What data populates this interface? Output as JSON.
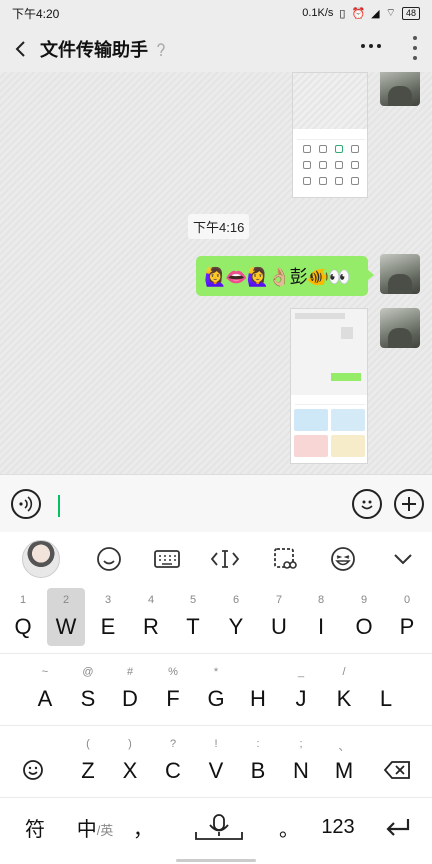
{
  "status_bar": {
    "time": "下午4:20",
    "network_speed": "0.1K/s",
    "battery": "48"
  },
  "header": {
    "title": "文件传输助手"
  },
  "chat": {
    "timestamp": "下午4:16",
    "message_text": "🙋‍♀️👄🙋‍♀️👌🏼彭🐠👀"
  },
  "input": {
    "value": ""
  },
  "keyboard": {
    "row1": [
      {
        "main": "Q",
        "sub": "1"
      },
      {
        "main": "W",
        "sub": "2"
      },
      {
        "main": "E",
        "sub": "3"
      },
      {
        "main": "R",
        "sub": "4"
      },
      {
        "main": "T",
        "sub": "5"
      },
      {
        "main": "Y",
        "sub": "6"
      },
      {
        "main": "U",
        "sub": "7"
      },
      {
        "main": "I",
        "sub": "8"
      },
      {
        "main": "O",
        "sub": "9"
      },
      {
        "main": "P",
        "sub": "0"
      }
    ],
    "row2": [
      {
        "main": "A",
        "sub": "~"
      },
      {
        "main": "S",
        "sub": "@"
      },
      {
        "main": "D",
        "sub": "#"
      },
      {
        "main": "F",
        "sub": "%"
      },
      {
        "main": "G",
        "sub": "*"
      },
      {
        "main": "H",
        "sub": ""
      },
      {
        "main": "J",
        "sub": "_"
      },
      {
        "main": "K",
        "sub": "/"
      },
      {
        "main": "L",
        "sub": ""
      }
    ],
    "row3": [
      {
        "main": "Z",
        "sub": "("
      },
      {
        "main": "X",
        "sub": ")"
      },
      {
        "main": "C",
        "sub": "?"
      },
      {
        "main": "V",
        "sub": "!"
      },
      {
        "main": "B",
        "sub": ":"
      },
      {
        "main": "N",
        "sub": ";"
      },
      {
        "main": "M",
        "sub": "、"
      }
    ],
    "pressed_key": "W",
    "bottom": {
      "symbol": "符",
      "lang_main": "中",
      "lang_alt": "/英",
      "comma": "，",
      "period": "。",
      "numbers": "123"
    }
  }
}
